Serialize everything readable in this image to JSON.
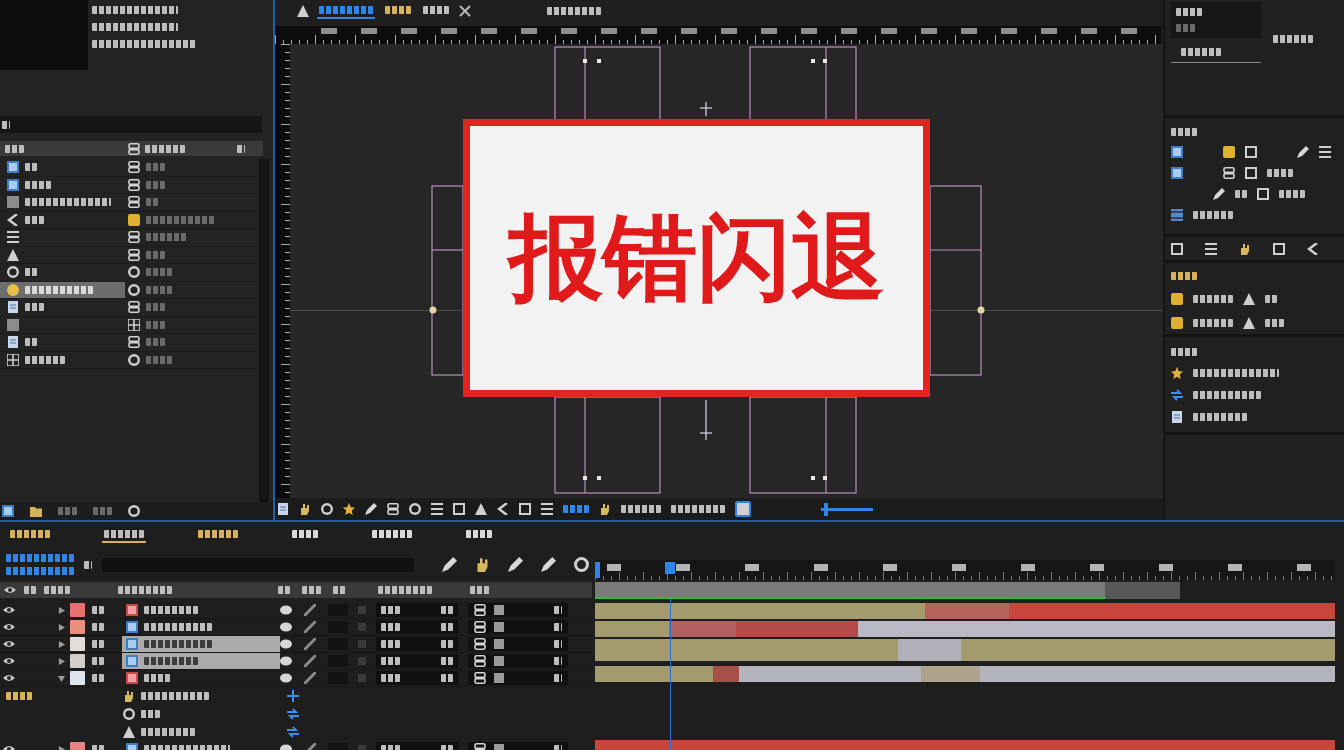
{
  "project": {
    "items": [
      {
        "selected": false
      },
      {
        "selected": false
      },
      {
        "selected": false
      },
      {
        "selected": false
      },
      {
        "selected": false
      },
      {
        "selected": false
      },
      {
        "selected": false
      },
      {
        "selected": true
      },
      {
        "selected": false
      },
      {
        "selected": false
      },
      {
        "selected": false
      },
      {
        "selected": false
      }
    ]
  },
  "viewer": {
    "tabs": [
      {
        "selected": true
      },
      {
        "selected": false
      },
      {
        "selected": false
      }
    ],
    "message": "报错闪退",
    "zoom_slider": {
      "level": 0.05
    }
  },
  "timeline": {
    "tabs": [
      {
        "selected": false
      },
      {
        "selected": true
      },
      {
        "selected": false
      },
      {
        "selected": false
      },
      {
        "selected": false
      },
      {
        "selected": false
      }
    ],
    "layers": [
      {
        "color": "#e86f6f",
        "selected": false,
        "expanded": false
      },
      {
        "color": "#e8907c",
        "selected": false,
        "expanded": false
      },
      {
        "color": "#e2ddd8",
        "selected": true,
        "expanded": false
      },
      {
        "color": "#d2cec9",
        "selected": true,
        "expanded": false
      },
      {
        "color": "#dfe5ee",
        "selected": false,
        "expanded": true
      },
      {
        "color": "#e88383",
        "selected": false,
        "expanded": false
      }
    ]
  }
}
